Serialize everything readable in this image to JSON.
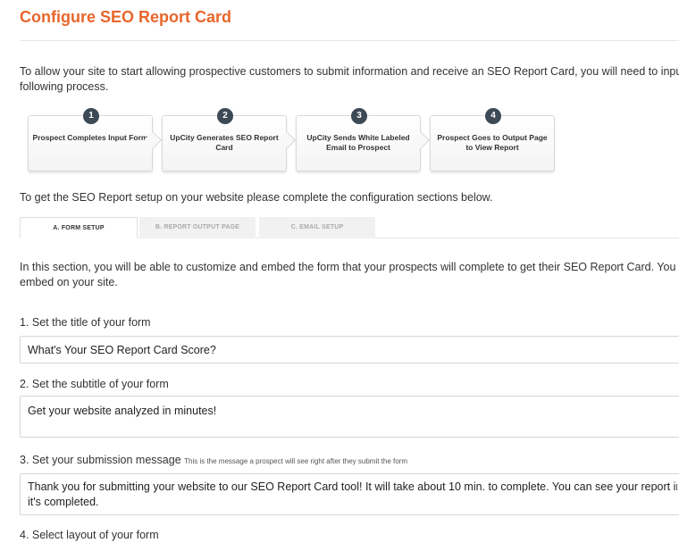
{
  "page": {
    "title": "Configure SEO Report Card",
    "intro_line1": "To allow your site to start allowing prospective customers to submit information and receive an SEO Report Card, you will need to input",
    "intro_line2": "following process."
  },
  "steps": [
    {
      "number": "1",
      "label": "Prospect Completes Input Form"
    },
    {
      "number": "2",
      "label": "UpCity Generates SEO Report Card"
    },
    {
      "number": "3",
      "label": "UpCity Sends White Labeled Email to Prospect"
    },
    {
      "number": "4",
      "label": "Prospect Goes to Output Page to View Report"
    }
  ],
  "setup_text": "To get the SEO Report setup on your website please complete the configuration sections below.",
  "tabs": [
    {
      "label": "A. FORM SETUP",
      "active": true
    },
    {
      "label": "B. REPORT OUTPUT PAGE",
      "active": false
    },
    {
      "label": "C. EMAIL SETUP",
      "active": false
    }
  ],
  "section": {
    "line1": "In this section, you will be able to customize and embed the form that your prospects will complete to get their SEO Report Card. You c",
    "line2": "embed on your site."
  },
  "fields": {
    "title": {
      "label": "1. Set the title of your form",
      "value": "What's Your SEO Report Card Score?"
    },
    "subtitle": {
      "label": "2. Set the subtitle of your form",
      "value": "Get your website analyzed in minutes!"
    },
    "submission": {
      "label": "3. Set your submission message",
      "hint": "This is the message a prospect will see right after they submit the form",
      "value_line1": "Thank you for submitting your website to our SEO Report Card tool! It will take about 10 min. to complete. You can see your report in",
      "value_line2": "it's completed."
    },
    "layout": {
      "label": "4. Select layout of your form"
    }
  },
  "colors": {
    "title": "#e8662b",
    "step_badge": "#3d4a55",
    "inactive_tab_bg": "#f1f1f1",
    "inactive_tab_text": "#aaaaaa"
  }
}
